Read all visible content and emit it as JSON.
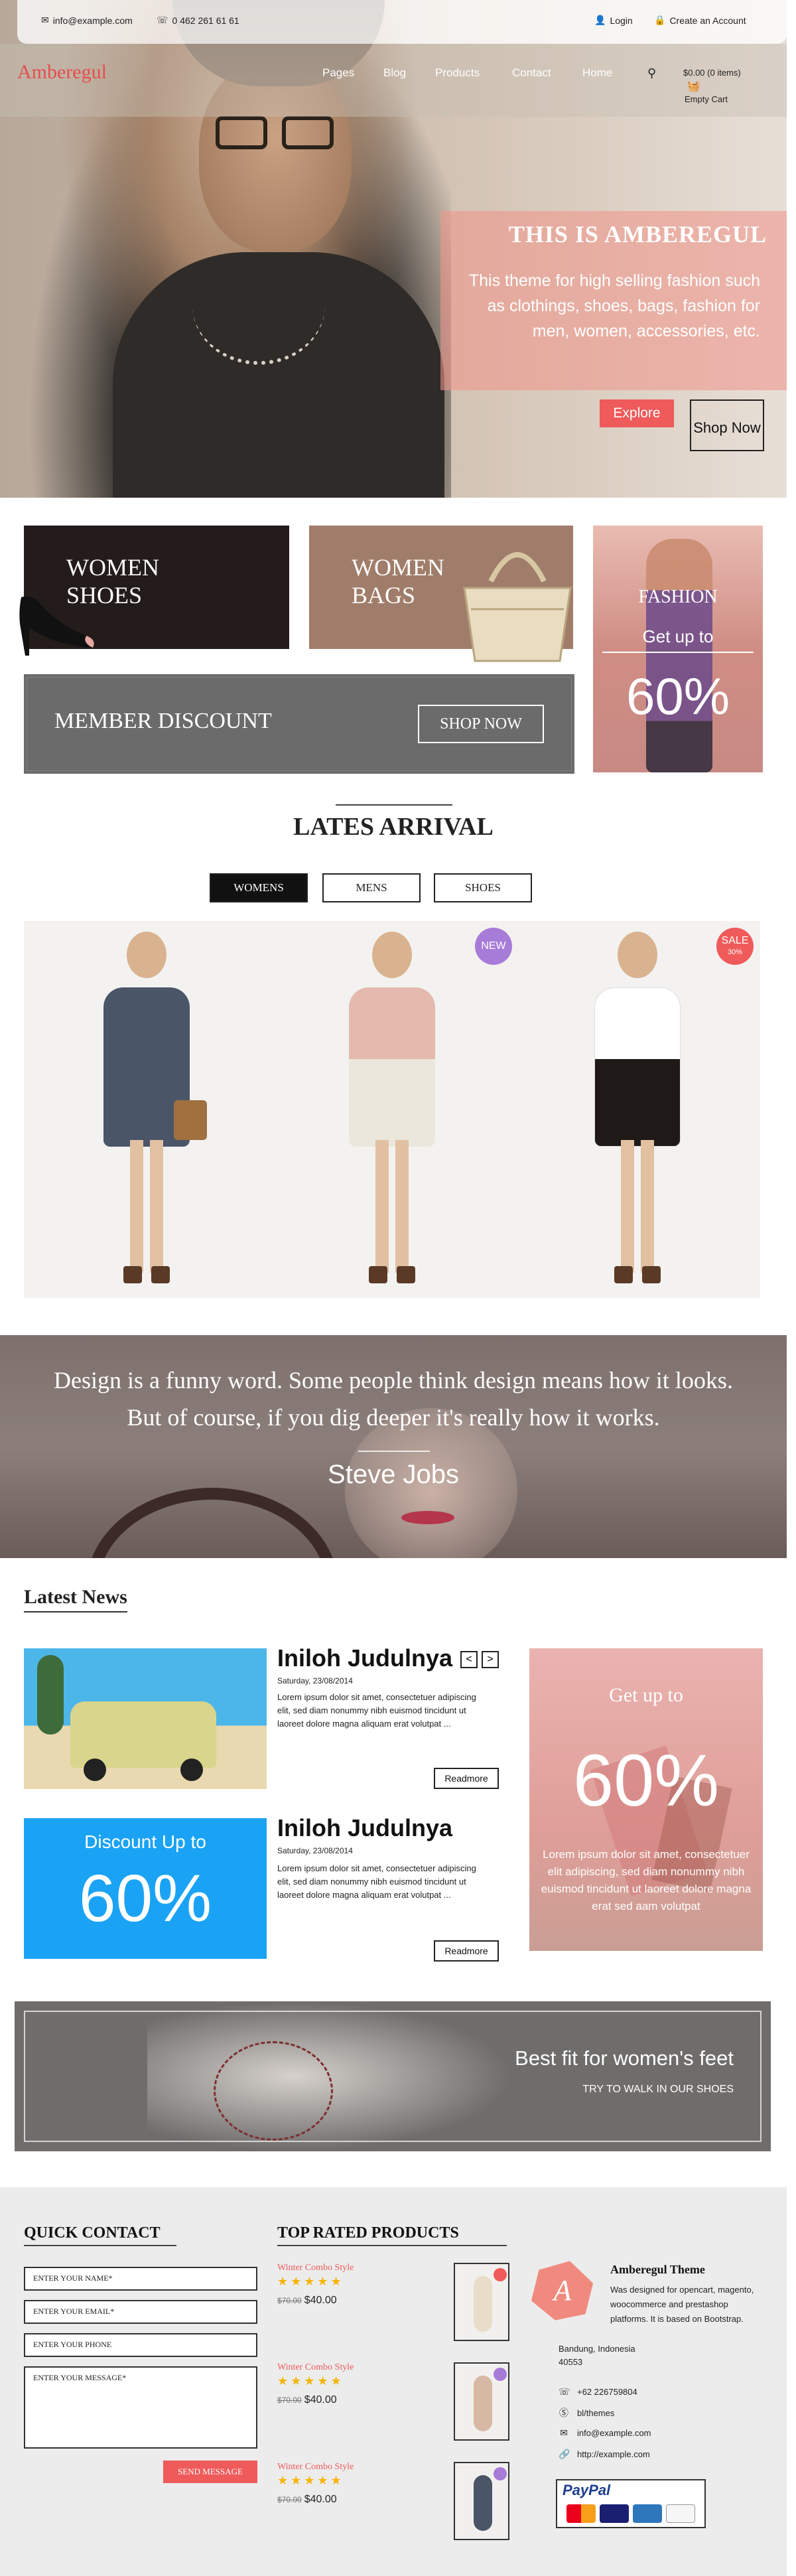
{
  "topbar": {
    "email": "info@example.com",
    "phone": "0 462 261 61 61",
    "login": "Login",
    "create_account": "Create an Account"
  },
  "nav": {
    "logo": "Amberegul",
    "items": [
      "Pages",
      "Blog",
      "Products",
      "Contact",
      "Home"
    ],
    "cart_total": "$0.00 (0 items)",
    "cart_status": "Empty Cart"
  },
  "hero": {
    "title": "THIS IS AMBEREGUL",
    "text": "This theme for high selling fashion such as clothings, shoes, bags, fashion for men, women, accessories, etc.",
    "explore": "Explore",
    "shop_now": "Shop Now"
  },
  "banners": {
    "shoes_line1": "WOMEN",
    "shoes_line2": "SHOES",
    "bags_line1": "WOMEN",
    "bags_line2": "BAGS",
    "fashion_title": "FASHION",
    "fashion_sub": "Get up to",
    "fashion_pct": "60%",
    "member_title": "MEMBER DISCOUNT",
    "member_button": "SHOP NOW"
  },
  "arrival": {
    "title": "LATES ARRIVAL",
    "tabs": [
      "WOMENS",
      "MENS",
      "SHOES"
    ],
    "badge_new": "NEW",
    "badge_sale": "SALE",
    "badge_sale_pct": "30%"
  },
  "quote": {
    "text": "Design is a funny word. Some people think design means how it looks. But of course, if you dig deeper it's really how it works.",
    "author": "Steve Jobs"
  },
  "news": {
    "title": "Latest News",
    "items": [
      {
        "heading": "Iniloh Judulnya",
        "date": "Saturday, 23/08/2014",
        "text": "Lorem ipsum dolor sit amet, consectetuer adipiscing elit, sed diam nonummy nibh euismod tincidunt ut laoreet dolore magna aliquam erat volutpat ...",
        "button": "Readmore"
      },
      {
        "heading": "Iniloh Judulnya",
        "date": "Saturday, 23/08/2014",
        "text": "Lorem ipsum dolor sit amet, consectetuer adipiscing elit, sed diam nonummy nibh euismod tincidunt ut laoreet dolore magna aliquam erat volutpat ...",
        "button": "Readmore"
      }
    ],
    "discount_title": "Discount Up to",
    "discount_pct": "60%",
    "promo_title": "Get up to",
    "promo_pct": "60%",
    "promo_text": "Lorem ipsum dolor sit amet, consectetuer elit adipiscing, sed diam nonummy nibh euismod tincidunt ut laoreet dolore magna erat sed aam volutpat"
  },
  "bestfit": {
    "title": "Best fit for women's feet",
    "subtitle": "TRY TO WALK IN OUR SHOES"
  },
  "footer": {
    "contact_title": "QUICK CONTACT",
    "name_placeholder": "ENTER YOUR NAME*",
    "email_placeholder": "ENTER YOUR EMAIL*",
    "phone_placeholder": "ENTER YOUR PHONE",
    "message_placeholder": "ENTER YOUR MESSAGE*",
    "send": "SEND MESSAGE",
    "products_title": "TOP RATED PRODUCTS",
    "products": [
      {
        "name": "Winter Combo Style",
        "stars": "★★★★★",
        "old_price": "$70.00",
        "price": "$40.00"
      },
      {
        "name": "Winter Combo Style",
        "stars": "★★★★★",
        "old_price": "$70.00",
        "price": "$40.00"
      },
      {
        "name": "Winter Combo Style",
        "stars": "★★★★★",
        "old_price": "$70.00",
        "price": "$40.00"
      }
    ],
    "brand": "Amberegul Theme",
    "brand_desc": "Was designed for opencart, magento, woocommerce and prestashop platforms. It is based on Bootstrap.",
    "address_line1": "Bandung, Indonesia",
    "address_line2": "40553",
    "phone": "+62 226759804",
    "skype": "bl/themes",
    "email": "info@example.com",
    "website": "http://example.com",
    "paypal": "PayPal"
  },
  "colors": {
    "accent": "#ef5a5a",
    "dark": "#111111",
    "discount_blue": "#1aa3f5",
    "badge_purple": "#a77bd8"
  }
}
